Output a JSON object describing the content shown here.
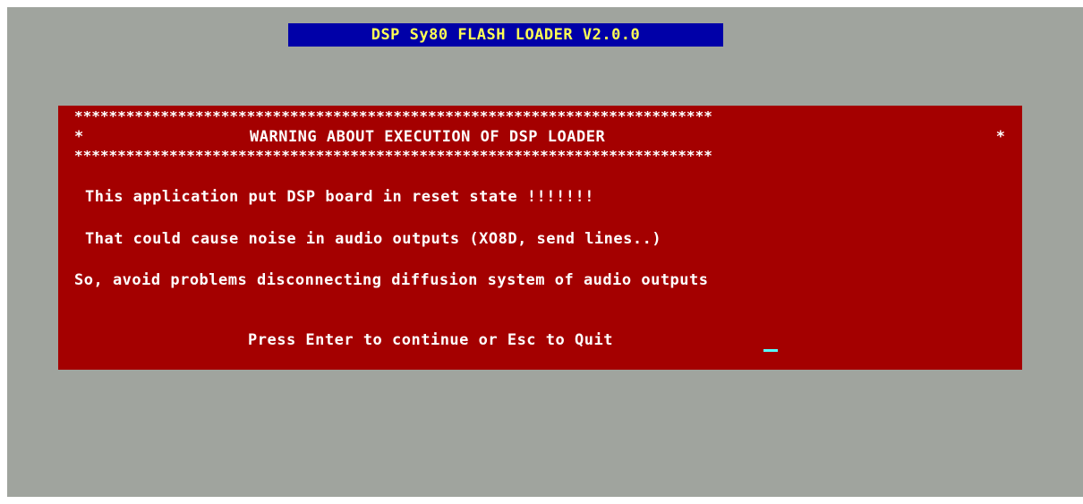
{
  "app": {
    "title": "DSP Sy80 FLASH LOADER V2.0.0"
  },
  "dialog": {
    "border_stars": "**************************************************************************",
    "header_star_left": "*",
    "header_star_right": "*",
    "heading": "WARNING ABOUT EXECUTION OF DSP LOADER",
    "messages": [
      "This application put DSP board in reset state !!!!!!!",
      "That could cause noise in audio outputs (XO8D, send lines..)",
      "So, avoid problems disconnecting diffusion system of audio outputs"
    ],
    "prompt": "Press Enter to continue or Esc to Quit"
  },
  "colors": {
    "screen_background": "#a0a49e",
    "title_background": "#0000a8",
    "title_text": "#ffff55",
    "dialog_background": "#a40000",
    "dialog_text": "#ffffff",
    "cursor": "#55ffff"
  }
}
